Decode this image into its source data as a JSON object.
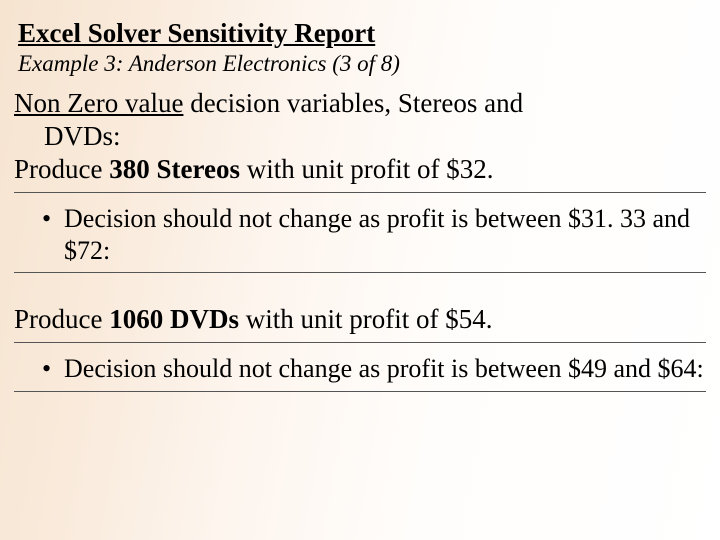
{
  "title": "Excel Solver Sensitivity Report",
  "subtitle": "Example 3: Anderson Electronics (3 of 8)",
  "intro": {
    "nonzero_label": "Non Zero value",
    "rest_line1": " decision variables, Stereos and",
    "line2": "DVDs:"
  },
  "stereo": {
    "line_a": "Produce ",
    "line_b_bold": "380 Stereos ",
    "line_c": "with unit profit of $32.",
    "bullet": "Decision should not change as profit is between $31. 33 and $72:"
  },
  "dvd": {
    "line_a": "Produce ",
    "line_b_bold": "1060 DVDs ",
    "line_c": "with unit profit of $54.",
    "bullet": "Decision should not change as profit is between $49 and $64:"
  },
  "bullet_char": "•"
}
